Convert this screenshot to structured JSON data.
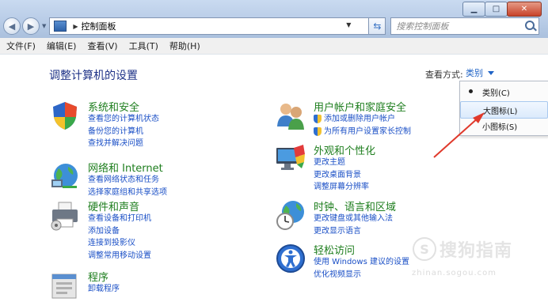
{
  "address": {
    "crumb": "控制面板"
  },
  "search": {
    "placeholder": "搜索控制面板"
  },
  "menu": [
    "文件(F)",
    "编辑(E)",
    "查看(V)",
    "工具(T)",
    "帮助(H)"
  ],
  "page_title": "调整计算机的设置",
  "view_by": {
    "label": "查看方式:",
    "value": "类别"
  },
  "dropdown": {
    "items": [
      "类别(C)",
      "大图标(L)",
      "小图标(S)"
    ],
    "selected_index": 0,
    "hover_index": 1
  },
  "categories_left": [
    {
      "title": "系统和安全",
      "icon": "shield-icon",
      "links": [
        "查看您的计算机状态",
        "备份您的计算机",
        "查找并解决问题"
      ]
    },
    {
      "title": "网络和 Internet",
      "icon": "network-globe-icon",
      "links": [
        "查看网络状态和任务",
        "选择家庭组和共享选项"
      ]
    },
    {
      "title": "硬件和声音",
      "icon": "printer-icon",
      "links": [
        "查看设备和打印机",
        "添加设备",
        "连接到投影仪",
        "调整常用移动设置"
      ]
    },
    {
      "title": "程序",
      "icon": "programs-icon",
      "links": [
        "卸载程序"
      ]
    }
  ],
  "categories_right": [
    {
      "title": "用户帐户和家庭安全",
      "icon": "users-icon",
      "links": [
        "添加或删除用户帐户",
        "为所有用户设置家长控制"
      ]
    },
    {
      "title": "外观和个性化",
      "icon": "display-paint-icon",
      "links": [
        "更改主题",
        "更改桌面背景",
        "调整屏幕分辨率"
      ]
    },
    {
      "title": "时钟、语言和区域",
      "icon": "clock-globe-icon",
      "links": [
        "更改键盘或其他输入法",
        "更改显示语言"
      ]
    },
    {
      "title": "轻松访问",
      "icon": "ease-of-access-icon",
      "links": [
        "使用 Windows 建议的设置",
        "优化视频显示"
      ]
    }
  ],
  "colors": {
    "category_title": "#1e7e1e",
    "link": "#1a4fc6",
    "page_title": "#1e3287",
    "arrow": "#e0392b"
  },
  "watermark": {
    "text": "搜狗指南",
    "url": "zhinan.sogou.com"
  }
}
